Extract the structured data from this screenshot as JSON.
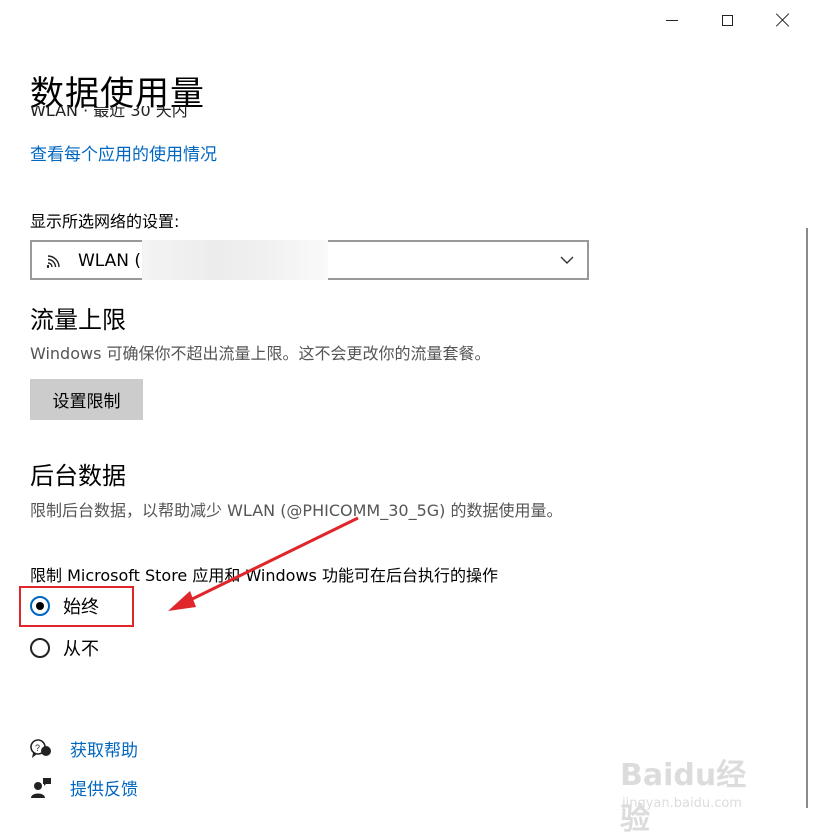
{
  "window": {
    "controls": [
      "minimize-icon",
      "maximize-icon",
      "close-icon"
    ]
  },
  "page": {
    "title": "数据使用量",
    "clipped_text": "WLAN · 最近 30 天内",
    "usage_link": "查看每个应用的使用情况"
  },
  "network": {
    "label": "显示所选网络的设置:",
    "selected": "WLAN (",
    "icon": "wifi-icon"
  },
  "data_limit": {
    "title": "流量上限",
    "description": "Windows 可确保你不超出流量上限。这不会更改你的流量套餐。",
    "button_label": "设置限制"
  },
  "background_data": {
    "title": "后台数据",
    "description": "限制后台数据，以帮助减少 WLAN (@PHICOMM_30_5G) 的数据使用量。",
    "restrict_label": "限制 Microsoft Store 应用和 Windows 功能可在后台执行的操作",
    "options": [
      {
        "label": "始终",
        "selected": true
      },
      {
        "label": "从不",
        "selected": false
      }
    ]
  },
  "links": {
    "help": "获取帮助",
    "feedback": "提供反馈"
  },
  "annotation": {
    "color": "#e0262a"
  },
  "watermark": {
    "text": "Baidu经验",
    "sub": "jingyan.baidu.com"
  },
  "colors": {
    "accent": "#0067c0",
    "button_bg": "#cccccc"
  }
}
